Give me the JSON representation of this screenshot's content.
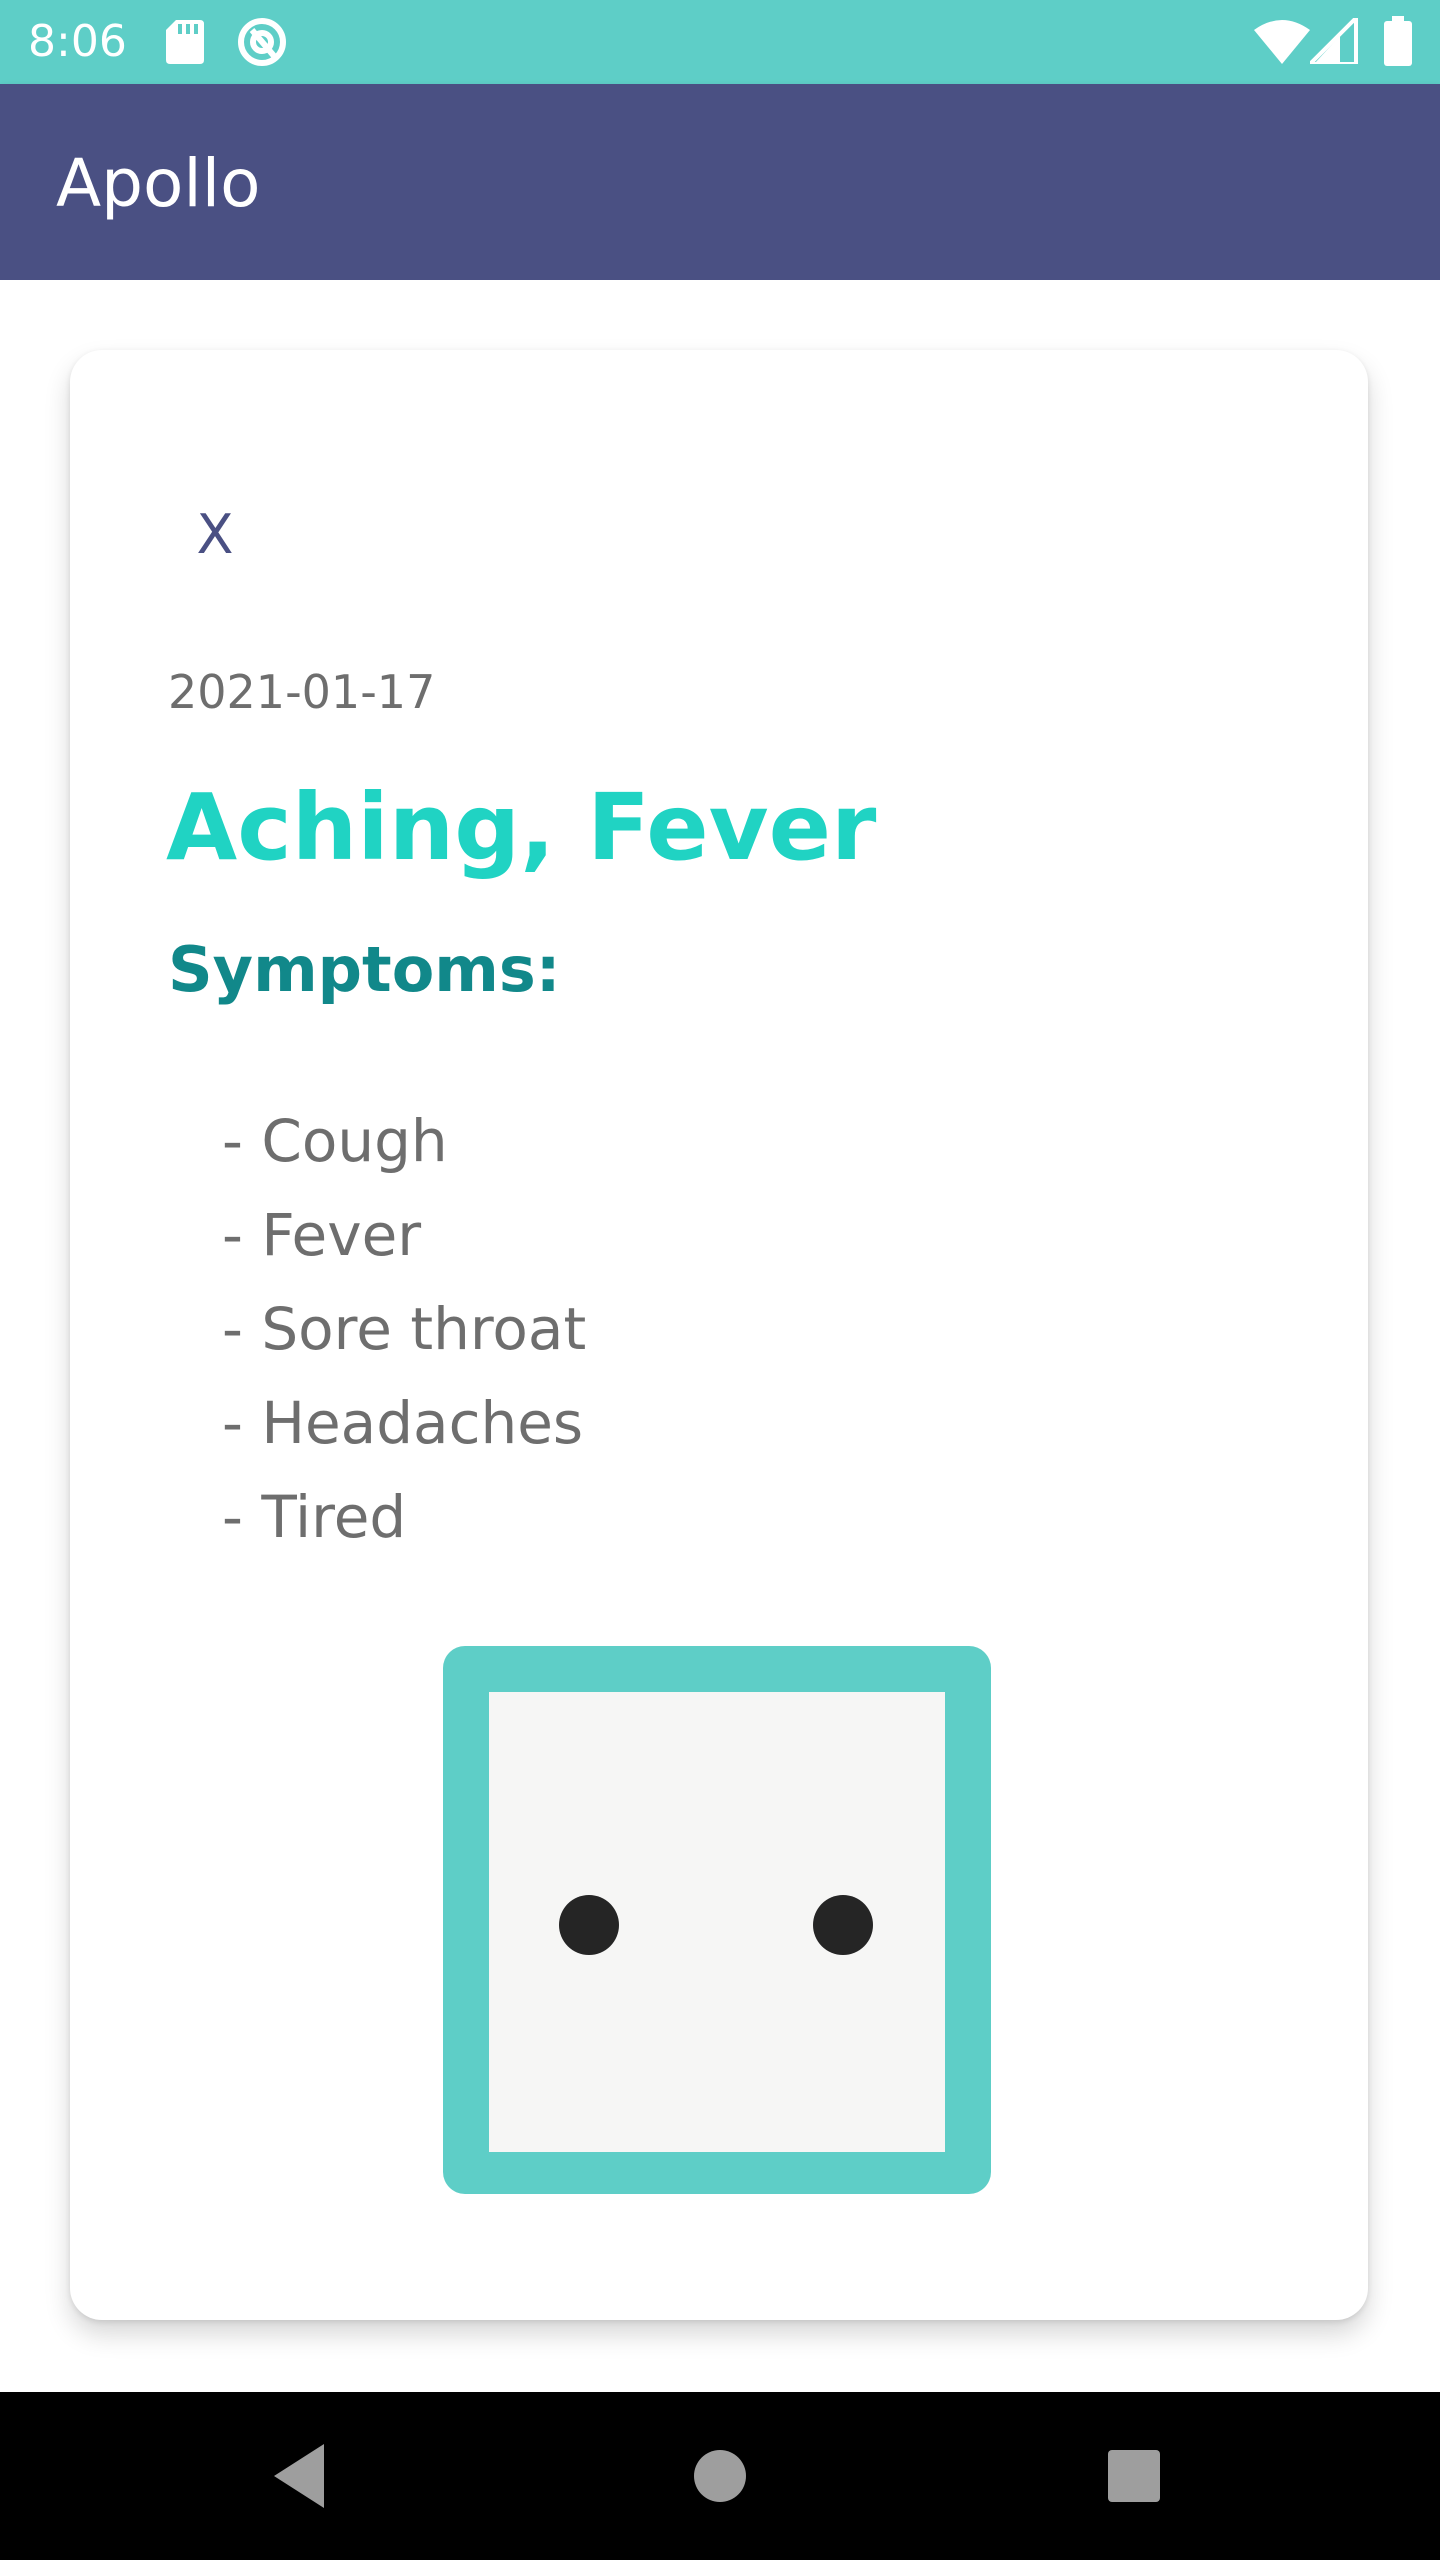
{
  "status_bar": {
    "time": "8:06",
    "left_icons": [
      "sd-card-icon",
      "at-sign-icon"
    ],
    "right_icons": [
      "wifi-icon",
      "cell-signal-icon",
      "battery-icon"
    ],
    "background": "#5ecec7"
  },
  "app_bar": {
    "title": "Apollo",
    "background": "#4a5083"
  },
  "card": {
    "close_label": "X",
    "date": "2021-01-17",
    "title": "Aching, Fever",
    "symptoms_heading": "Symptoms:",
    "symptoms": [
      "- Cough",
      "- Fever",
      "- Sore throat",
      "- Headaches",
      "- Tired"
    ],
    "mood_icon": "neutral-face-icon",
    "colors": {
      "title": "#20d3c3",
      "heading": "#11888a",
      "text": "#6e6e6e",
      "close": "#4a5083",
      "mood_frame": "#5ecec7"
    }
  },
  "nav_bar": {
    "buttons": [
      "back-icon",
      "home-icon",
      "recents-icon"
    ]
  }
}
